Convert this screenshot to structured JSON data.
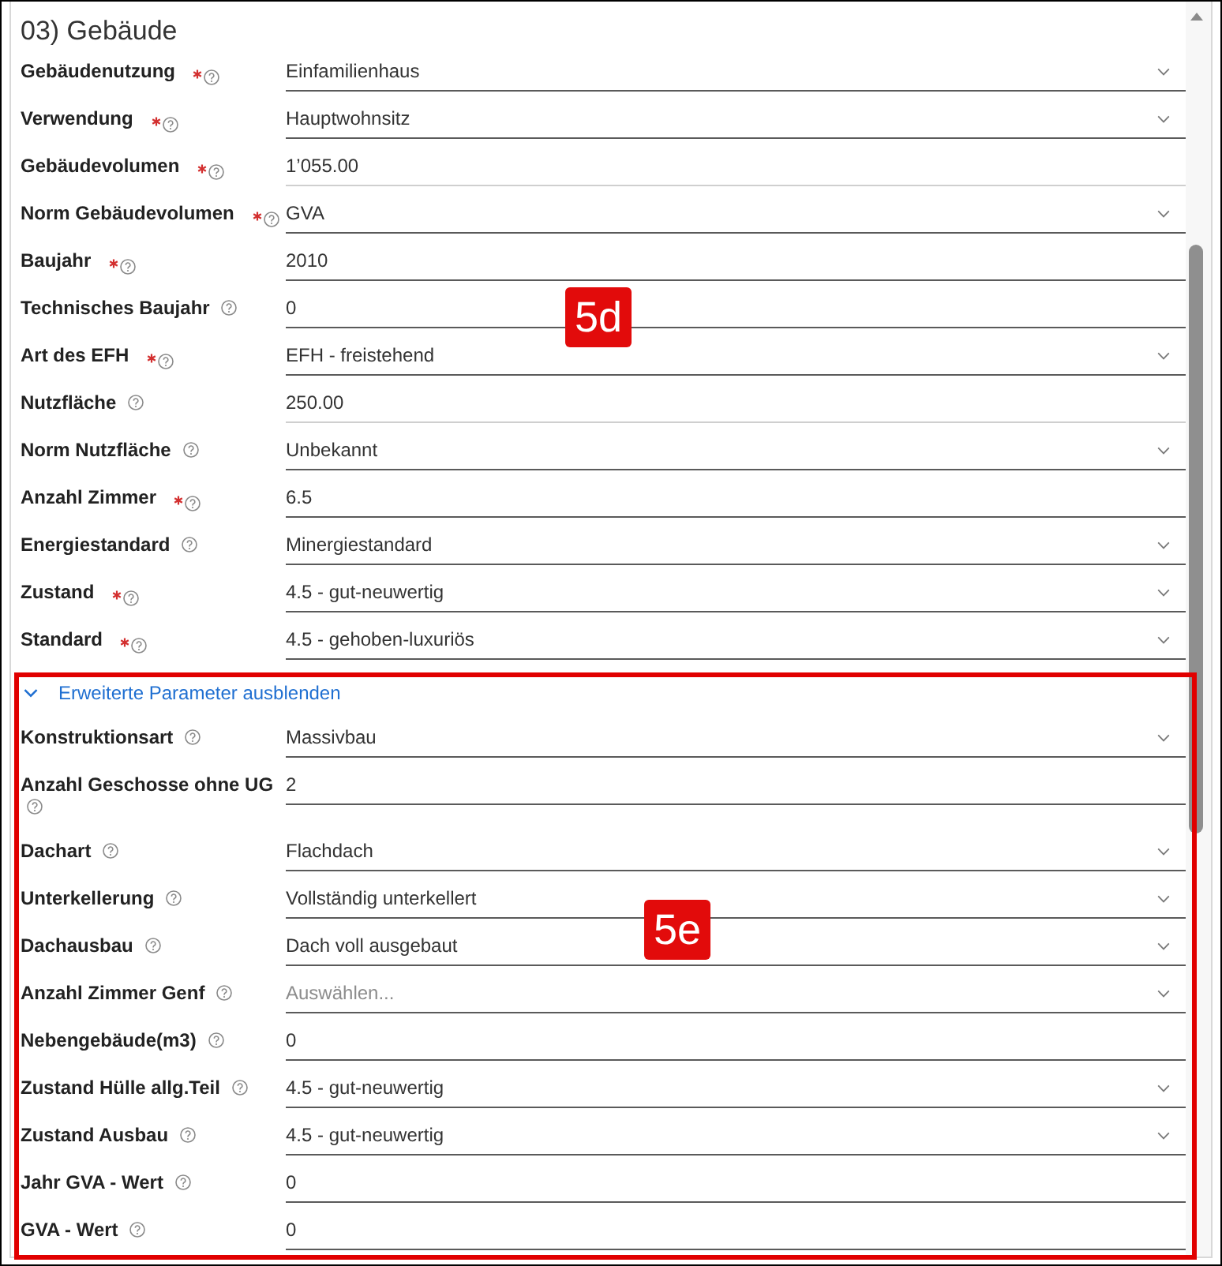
{
  "section": {
    "title": "03) Gebäude",
    "badge": "5d",
    "fields": [
      {
        "label": "Gebäudenutzung",
        "required": true,
        "kind": "select",
        "value": "Einfamilienhaus",
        "disabled": false
      },
      {
        "label": "Verwendung",
        "required": true,
        "kind": "select",
        "value": "Hauptwohnsitz",
        "disabled": false
      },
      {
        "label": "Gebäudevolumen",
        "required": true,
        "kind": "text",
        "value": "1’055.00",
        "disabled": true
      },
      {
        "label": "Norm Gebäudevolumen",
        "required": true,
        "kind": "select",
        "value": "GVA",
        "disabled": false
      },
      {
        "label": "Baujahr",
        "required": true,
        "kind": "text",
        "value": "2010",
        "disabled": false
      },
      {
        "label": "Technisches Baujahr",
        "required": false,
        "kind": "text",
        "value": "0",
        "disabled": false
      },
      {
        "label": "Art des EFH",
        "required": true,
        "kind": "select",
        "value": "EFH - freistehend",
        "disabled": false
      },
      {
        "label": "Nutzfläche",
        "required": false,
        "kind": "text",
        "value": "250.00",
        "disabled": true
      },
      {
        "label": "Norm Nutzfläche",
        "required": false,
        "kind": "select",
        "value": "Unbekannt",
        "disabled": false
      },
      {
        "label": "Anzahl Zimmer",
        "required": true,
        "kind": "text",
        "value": "6.5",
        "disabled": false
      },
      {
        "label": "Energiestandard",
        "required": false,
        "kind": "select",
        "value": "Minergiestandard",
        "disabled": false
      },
      {
        "label": "Zustand",
        "required": true,
        "kind": "select",
        "value": "4.5 - gut-neuwertig",
        "disabled": false
      },
      {
        "label": "Standard",
        "required": true,
        "kind": "select",
        "value": "4.5 - gehoben-luxuriös",
        "disabled": false
      }
    ],
    "advanced": {
      "toggle_label": "Erweiterte Parameter ausblenden",
      "expanded": true,
      "highlighted": true,
      "badge": "5e",
      "fields": [
        {
          "label": "Konstruktionsart",
          "required": false,
          "kind": "select",
          "value": "Massivbau",
          "disabled": false
        },
        {
          "label": "Anzahl Geschosse ohne UG",
          "required": false,
          "kind": "text",
          "value": "2",
          "disabled": false
        },
        {
          "label": "Dachart",
          "required": false,
          "kind": "select",
          "value": "Flachdach",
          "disabled": false
        },
        {
          "label": "Unterkellerung",
          "required": false,
          "kind": "select",
          "value": "Vollständig unterkellert",
          "disabled": false
        },
        {
          "label": "Dachausbau",
          "required": false,
          "kind": "select",
          "value": "Dach voll ausgebaut",
          "disabled": false
        },
        {
          "label": "Anzahl Zimmer Genf",
          "required": false,
          "kind": "select",
          "placeholder": "Auswählen...",
          "disabled": false
        },
        {
          "label": "Nebengebäude(m3)",
          "required": false,
          "kind": "text",
          "value": "0",
          "disabled": false
        },
        {
          "label": "Zustand Hülle allg.Teil",
          "required": false,
          "kind": "select",
          "value": "4.5 - gut-neuwertig",
          "disabled": false
        },
        {
          "label": "Zustand Ausbau",
          "required": false,
          "kind": "select",
          "value": "4.5 - gut-neuwertig",
          "disabled": false
        },
        {
          "label": "Jahr GVA - Wert",
          "required": false,
          "kind": "text",
          "value": "0",
          "disabled": false
        },
        {
          "label": "GVA - Wert",
          "required": false,
          "kind": "text",
          "value": "0",
          "disabled": false
        }
      ]
    }
  }
}
